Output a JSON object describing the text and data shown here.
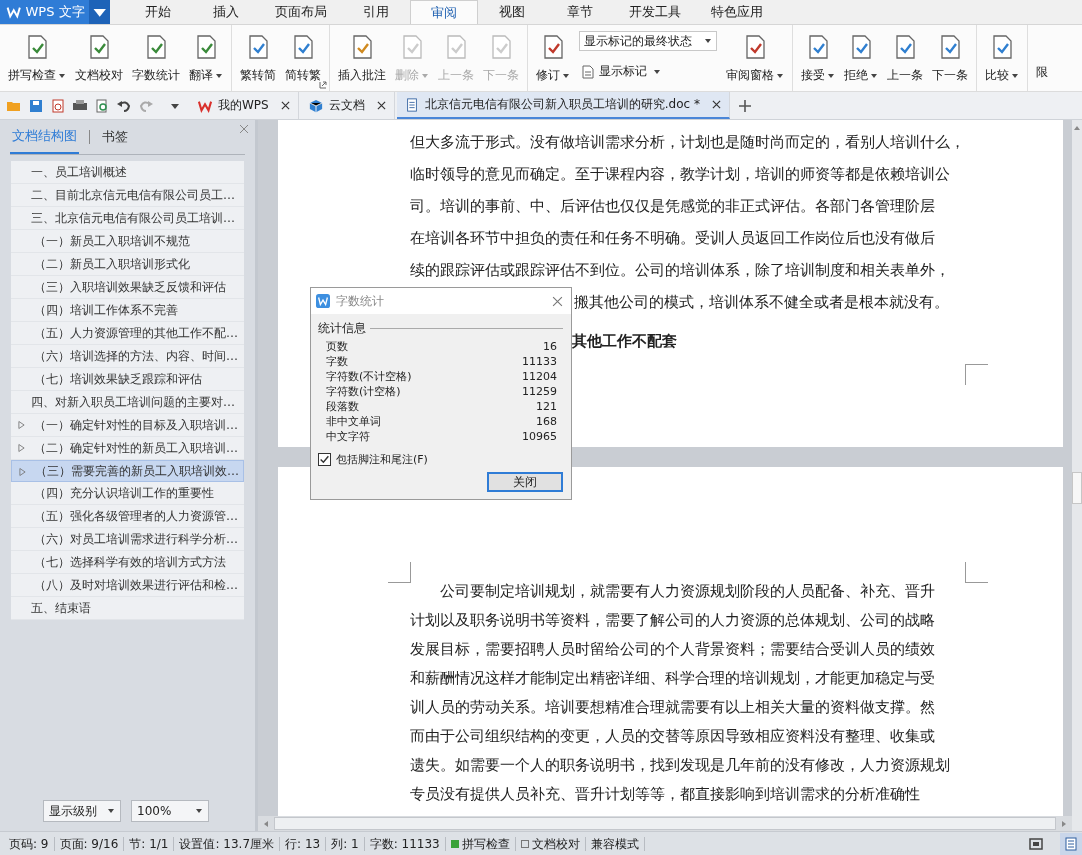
{
  "app_menu": {
    "label": "WPS 文字"
  },
  "menu_tabs": [
    {
      "label": "开始",
      "selected": false
    },
    {
      "label": "插入",
      "selected": false
    },
    {
      "label": "页面布局",
      "selected": false
    },
    {
      "label": "引用",
      "selected": false
    },
    {
      "label": "审阅",
      "selected": true
    },
    {
      "label": "视图",
      "selected": false
    },
    {
      "label": "章节",
      "selected": false
    },
    {
      "label": "开发工具",
      "selected": false
    },
    {
      "label": "特色应用",
      "selected": false
    }
  ],
  "ribbon": {
    "groups": [
      {
        "launcher": false,
        "items": [
          {
            "kind": "large",
            "label": "拼写检查",
            "dropdown": true,
            "disabled": false
          },
          {
            "kind": "large",
            "label": "文档校对",
            "dropdown": false,
            "disabled": false
          },
          {
            "kind": "large",
            "label": "字数统计",
            "dropdown": false,
            "disabled": false
          },
          {
            "kind": "large",
            "label": "翻译",
            "dropdown": true,
            "disabled": false
          }
        ]
      },
      {
        "launcher": true,
        "items": [
          {
            "kind": "large",
            "label": "繁转简",
            "dropdown": false,
            "disabled": false
          },
          {
            "kind": "large",
            "label": "简转繁",
            "dropdown": false,
            "disabled": false
          }
        ]
      },
      {
        "launcher": false,
        "items": [
          {
            "kind": "large",
            "label": "插入批注",
            "dropdown": false,
            "disabled": false
          },
          {
            "kind": "large",
            "label": "删除",
            "dropdown": true,
            "disabled": true
          },
          {
            "kind": "large",
            "label": "上一条",
            "dropdown": false,
            "disabled": true
          },
          {
            "kind": "large",
            "label": "下一条",
            "dropdown": false,
            "disabled": true
          }
        ]
      },
      {
        "launcher": false,
        "items": [
          {
            "kind": "large",
            "label": "修订",
            "dropdown": true,
            "disabled": false
          },
          {
            "kind": "stack",
            "select": "显示标记的最终状态",
            "label": "显示标记",
            "dropdown": true,
            "disabled": false
          },
          {
            "kind": "large",
            "label": "审阅窗格",
            "dropdown": true,
            "disabled": false
          }
        ]
      },
      {
        "launcher": false,
        "items": [
          {
            "kind": "large",
            "label": "接受",
            "dropdown": true,
            "disabled": false
          },
          {
            "kind": "large",
            "label": "拒绝",
            "dropdown": true,
            "disabled": false
          },
          {
            "kind": "large",
            "label": "上一条",
            "dropdown": false,
            "disabled": false
          },
          {
            "kind": "large",
            "label": "下一条",
            "dropdown": false,
            "disabled": false
          }
        ]
      },
      {
        "launcher": false,
        "items": [
          {
            "kind": "large",
            "label": "比较",
            "dropdown": true,
            "disabled": false
          }
        ]
      },
      {
        "launcher": false,
        "items": [
          {
            "kind": "cut",
            "label": "限",
            "disabled": false
          }
        ]
      }
    ]
  },
  "doc_tabs": [
    {
      "label": "我的WPS",
      "selected": false
    },
    {
      "label": "云文档",
      "selected": false
    },
    {
      "label": "北京信元电信有限公司新入职员工培训的研究.doc *",
      "selected": true
    }
  ],
  "nav_panel": {
    "tabs": [
      {
        "label": "文档结构图",
        "selected": true
      },
      {
        "label": "书签",
        "selected": false
      }
    ],
    "outline": [
      {
        "text": "一、员工培训概述",
        "selected": false,
        "collapsed": false
      },
      {
        "text": "二、目前北京信元电信有限公司员工…",
        "selected": false,
        "collapsed": false
      },
      {
        "text": "三、北京信元电信有限公司员工培训…",
        "selected": false,
        "collapsed": false,
        "children": [
          {
            "text": "（一）新员工入职培训不规范",
            "selected": false,
            "collapsed": false
          },
          {
            "text": "（二）新员工入职培训形式化",
            "selected": false,
            "collapsed": false
          },
          {
            "text": "（三）入职培训效果缺乏反馈和评估",
            "selected": false,
            "collapsed": false
          },
          {
            "text": "（四）培训工作体系不完善",
            "selected": false,
            "collapsed": false
          },
          {
            "text": "（五）人力资源管理的其他工作不配…",
            "selected": false,
            "collapsed": false
          },
          {
            "text": "（六）培训选择的方法、内容、时间…",
            "selected": false,
            "collapsed": false
          },
          {
            "text": "（七）培训效果缺乏跟踪和评估",
            "selected": false,
            "collapsed": false
          }
        ]
      },
      {
        "text": "四、对新入职员工培训问题的主要对…",
        "selected": false,
        "collapsed": false,
        "children": [
          {
            "text": "（一）确定针对性的目标及入职培训…",
            "selected": false,
            "collapsed": true
          },
          {
            "text": "（二）确定针对性的新员工入职培训…",
            "selected": false,
            "collapsed": true
          },
          {
            "text": "（三）需要完善的新员工入职培训效…",
            "selected": true,
            "collapsed": true
          },
          {
            "text": "（四）充分认识培训工作的重要性",
            "selected": false,
            "collapsed": false
          },
          {
            "text": "（五）强化各级管理者的人力资源管…",
            "selected": false,
            "collapsed": false
          },
          {
            "text": "（六）对员工培训需求进行科学分析…",
            "selected": false,
            "collapsed": false
          },
          {
            "text": "（七）选择科学有效的培训方式方法",
            "selected": false,
            "collapsed": false
          },
          {
            "text": "（八）及时对培训效果进行评估和检…",
            "selected": false,
            "collapsed": false
          }
        ]
      },
      {
        "text": "五、结束语",
        "selected": false,
        "collapsed": false
      }
    ],
    "level_select": "显示级别",
    "zoom_select": "100%"
  },
  "pages": [
    {
      "lines": [
        {
          "kind": "body",
          "text": "但大多流于形式。没有做培训需求分析，计划也是随时尚而定的，看别人培训什么，"
        },
        {
          "kind": "body",
          "text": "临时领导的意见而确定。至于课程内容，教学计划，培训的师资等都是依赖培训公"
        },
        {
          "kind": "body",
          "text": "司。培训的事前、中、后评估也仅仅是凭感觉的非正式评估。各部门各管理阶层"
        },
        {
          "kind": "body",
          "text": "在培训各环节中担负的责任和任务不明确。受训人员返回工作岗位后也没有做后"
        },
        {
          "kind": "body",
          "text": "续的跟踪评估或跟踪评估不到位。公司的培训体系，除了培训制度和相关表单外，"
        },
        {
          "kind": "covered",
          "text": "搬其他公司的模式，培训体系不健全或者是根本就没有。"
        },
        {
          "kind": "heading",
          "text": "其他工作不配套"
        }
      ]
    },
    {
      "lines": [
        {
          "kind": "indent",
          "text": "公司要制定培训规划，就需要有人力资源规划阶段的人员配备、补充、晋升"
        },
        {
          "kind": "body",
          "text": "计划以及职务说明书等资料，需要了解公司的人力资源的总体规划、公司的战略"
        },
        {
          "kind": "body",
          "text": "发展目标，需要招聘人员时留给公司的个人背景资料；需要结合受训人员的绩效"
        },
        {
          "kind": "body",
          "text": "和薪酬情况这样才能制定出精密详细、科学合理的培训规划，才能更加稳定与受"
        },
        {
          "kind": "body",
          "text": "训人员的劳动关系。培训要想精准合理就需要有以上相关大量的资料做支撑。然"
        },
        {
          "kind": "body",
          "text": "而由于公司组织结构的变更，人员的交替等原因导致相应资料没有整理、收集或"
        },
        {
          "kind": "body",
          "text": "遗失。如需要一个人的职务说明书，找到发现是几年前的没有修改，人力资源规划"
        },
        {
          "kind": "body",
          "text": "专员没有提供人员补充、晋升计划等等，都直接影响到培训需求的分析准确性"
        }
      ]
    }
  ],
  "word_count_dialog": {
    "title": "字数统计",
    "section": "统计信息",
    "rows": [
      {
        "label": "页数",
        "value": "16"
      },
      {
        "label": "字数",
        "value": "11133"
      },
      {
        "label": "字符数(不计空格)",
        "value": "11204"
      },
      {
        "label": "字符数(计空格)",
        "value": "11259"
      },
      {
        "label": "段落数",
        "value": "121"
      },
      {
        "label": "非中文单词",
        "value": "168"
      },
      {
        "label": "中文字符",
        "value": "10965"
      }
    ],
    "checkbox": {
      "label": "包括脚注和尾注(F)",
      "checked": true
    },
    "button": "关闭"
  },
  "status_bar": [
    {
      "kind": "text",
      "text": "页码: 9"
    },
    {
      "kind": "text",
      "text": "页面: 9/16"
    },
    {
      "kind": "text",
      "text": "节: 1/1"
    },
    {
      "kind": "text",
      "text": "设置值: 13.7厘米"
    },
    {
      "kind": "text",
      "text": "行: 13"
    },
    {
      "kind": "text",
      "text": "列: 1"
    },
    {
      "kind": "text",
      "text": "字数: 11133"
    },
    {
      "kind": "toggle",
      "text": "拼写检查",
      "on": true
    },
    {
      "kind": "toggle",
      "text": "文档校对",
      "on": false
    },
    {
      "kind": "text",
      "text": "兼容模式"
    }
  ]
}
